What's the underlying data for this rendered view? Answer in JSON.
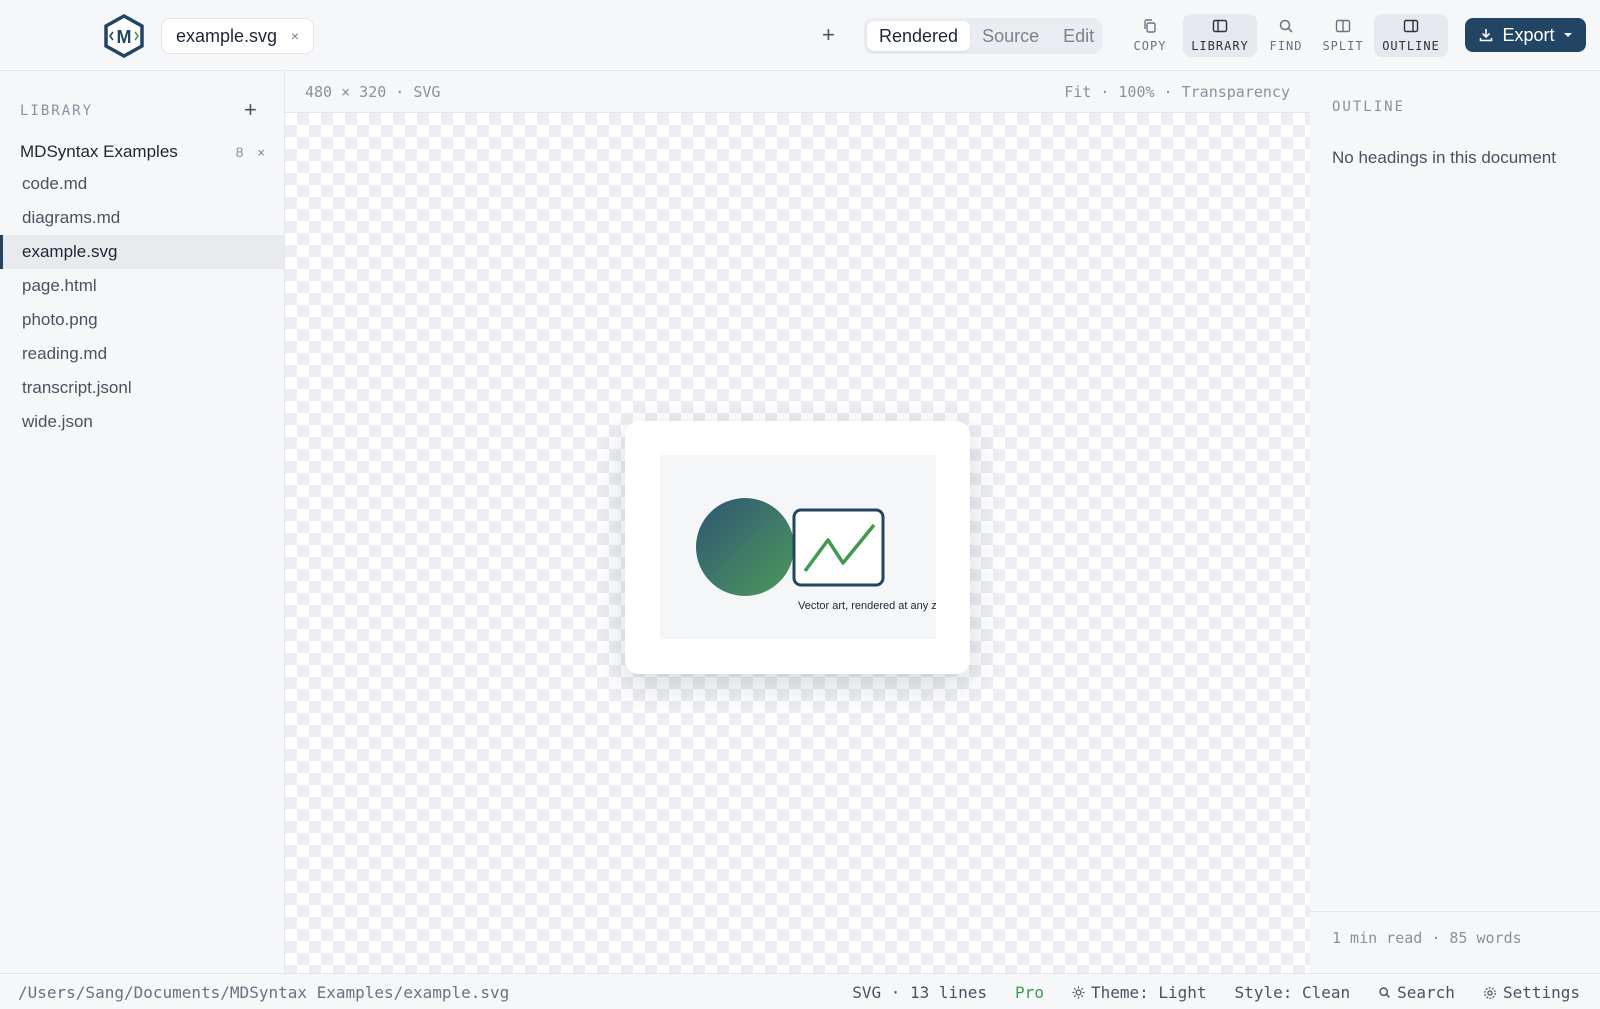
{
  "header": {
    "tab_title": "example.svg",
    "tab_close": "×",
    "new_tab": "+",
    "view_modes": [
      "Rendered",
      "Source",
      "Edit"
    ],
    "active_view": "Rendered",
    "tools": {
      "copy": "COPY",
      "library": "LIBRARY",
      "find": "FIND",
      "split": "SPLIT",
      "outline": "OUTLINE"
    },
    "export_label": "Export",
    "colors": {
      "accent": "#214562",
      "logo_blue": "#214562",
      "logo_green": "#3f9a4d"
    }
  },
  "sidebar": {
    "heading": "LIBRARY",
    "add": "+",
    "group": {
      "name": "MDSyntax Examples",
      "count": "8",
      "close": "×"
    },
    "files": [
      {
        "name": "code.md"
      },
      {
        "name": "diagrams.md"
      },
      {
        "name": "example.svg",
        "active": true
      },
      {
        "name": "page.html"
      },
      {
        "name": "photo.png"
      },
      {
        "name": "reading.md"
      },
      {
        "name": "transcript.jsonl"
      },
      {
        "name": "wide.json"
      }
    ]
  },
  "main": {
    "info_left": "480 × 320 · SVG",
    "info_right": "Fit · 100% · Transparency",
    "artwork": {
      "caption": "Vector art, rendered at any zoom",
      "gradient_start": "#2f5575",
      "gradient_end": "#4c9a5a",
      "frame_color": "#214562",
      "line_color": "#3f9a4d"
    }
  },
  "outline": {
    "heading": "OUTLINE",
    "empty_text": "No headings in this document",
    "stats": "1 min read · 85 words"
  },
  "status": {
    "path": "/Users/Sang/Documents/MDSyntax Examples/example.svg",
    "format": "SVG · 13 lines",
    "plan": "Pro",
    "theme": "Theme: Light",
    "style": "Style: Clean",
    "search": "Search",
    "settings": "Settings"
  }
}
